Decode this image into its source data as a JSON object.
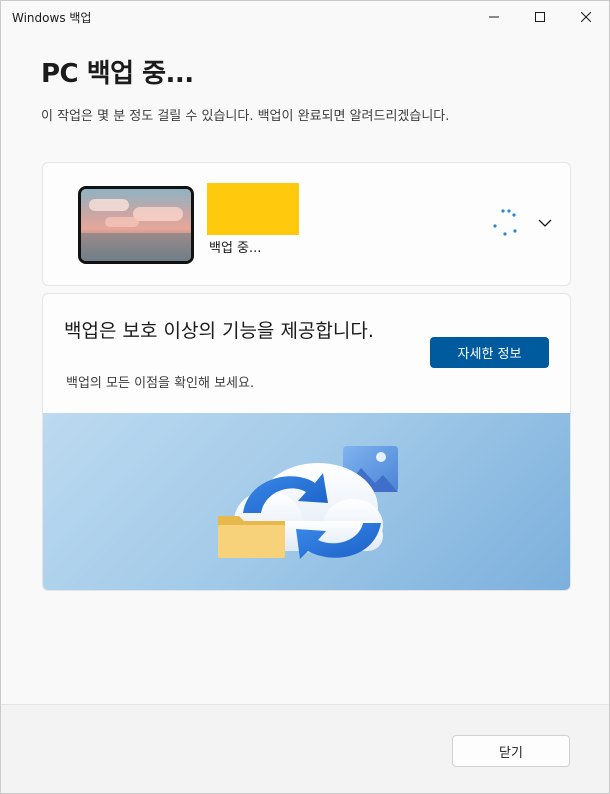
{
  "window": {
    "title": "Windows 백업",
    "controls": {
      "minimize_icon": "minimize-icon",
      "maximize_icon": "maximize-icon",
      "close_icon": "close-icon"
    }
  },
  "header": {
    "title": "PC 백업 중...",
    "subtitle": "이 작업은 몇 분 정도 걸릴 수 있습니다. 백업이 완료되면 알려드리겠습니다."
  },
  "device_card": {
    "status": "백업 중...",
    "thumbnail": "desktop-wallpaper-thumbnail",
    "redaction_color": "#ffc90e",
    "progress_icon": "loading-spinner-icon",
    "expand_icon": "chevron-down-icon"
  },
  "promo_card": {
    "title": "백업은 보호 이상의 기능을 제공합니다.",
    "subtitle": "백업의 모든 이점을 확인해 보세요.",
    "button_label": "자세한 정보",
    "illustration": "cloud-sync-illustration"
  },
  "footer": {
    "close_label": "닫기"
  },
  "colors": {
    "accent": "#005a9e",
    "banner": "#a4cbe9"
  }
}
